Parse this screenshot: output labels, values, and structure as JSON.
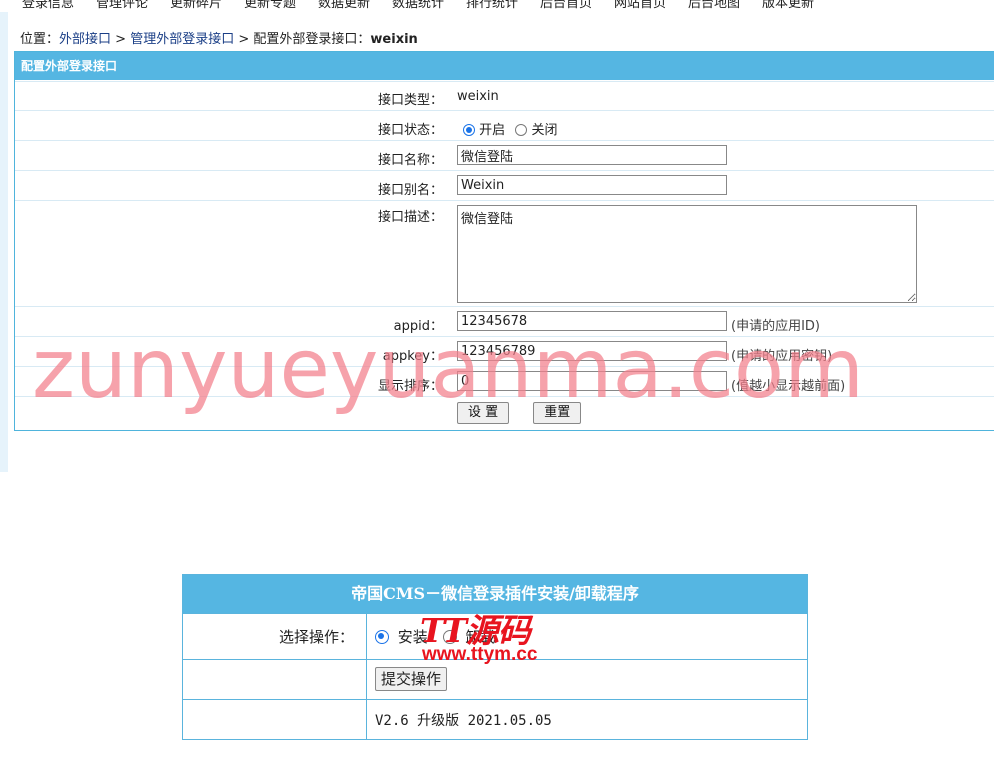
{
  "nav": [
    "登录信息",
    "管理评论",
    "更新碎片",
    "更新专题",
    "数据更新",
    "数据统计",
    "排行统计",
    "后台首页",
    "网站首页",
    "后台地图",
    "版本更新"
  ],
  "breadcrumb": {
    "prefix": "位置：",
    "item1": "外部接口",
    "sep": " > ",
    "item2": "管理外部登录接口",
    "item3": "配置外部登录接口：",
    "current": "weixin"
  },
  "config": {
    "header": "配置外部登录接口",
    "type_label": "接口类型：",
    "type_value": "weixin",
    "status_label": "接口状态：",
    "status_on": "开启",
    "status_off": "关闭",
    "name_label": "接口名称：",
    "name_value": "微信登陆",
    "alias_label": "接口别名：",
    "alias_value": "Weixin",
    "desc_label": "接口描述：",
    "desc_value": "微信登陆",
    "appid_label": "appid：",
    "appid_value": "12345678",
    "appid_hint": "(申请的应用ID)",
    "appkey_label": "appkey：",
    "appkey_value": "123456789",
    "appkey_hint": "(申请的应用密钥)",
    "order_label": "显示排序：",
    "order_value": "0",
    "order_hint": "(值越小显示越前面)",
    "submit_label": "设 置",
    "reset_label": "重置"
  },
  "watermark": "zunyueyuanma.com",
  "installer": {
    "title": "帝国CMS－微信登录插件安装/卸载程序",
    "op_label": "选择操作：",
    "install": "安装",
    "uninstall": "卸载",
    "submit": "提交操作",
    "version": "V2.6 升级版 2021.05.05"
  },
  "logo": {
    "text1": "TT源码",
    "text2": "www.ttym.cc"
  },
  "colors": {
    "header_blue": "#55b6e2",
    "watermark_pink": "#f27e8b",
    "logo_red": "#e8141f"
  }
}
